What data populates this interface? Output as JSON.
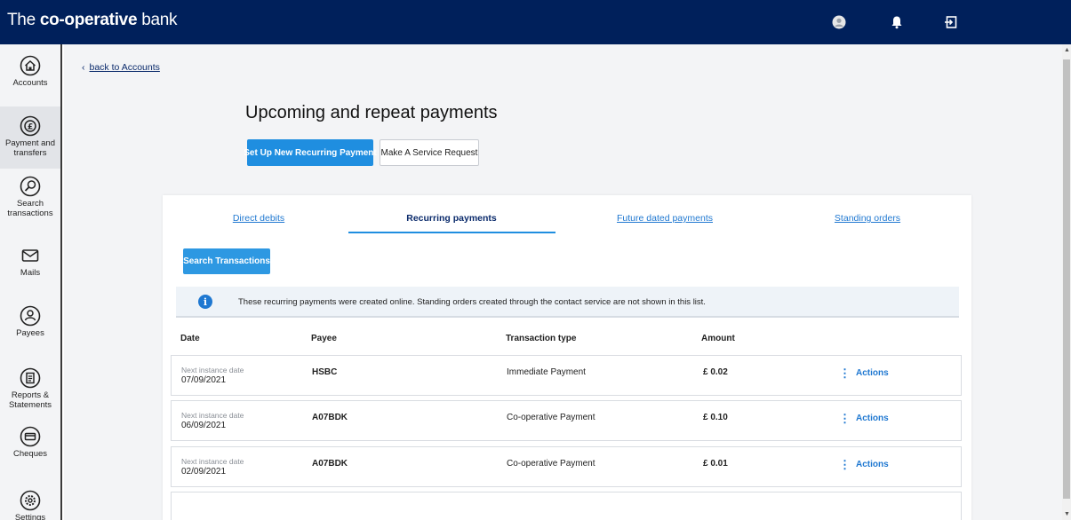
{
  "header": {
    "brand_prefix": "The ",
    "brand_bold": "co-operative",
    "brand_suffix": " bank",
    "colors": {
      "bar": "#00205b",
      "accent": "#1f8ee0",
      "link": "#1f78d1"
    },
    "icons": [
      "user-avatar-icon",
      "bell-icon",
      "logout-icon"
    ]
  },
  "sidebar": {
    "items": [
      {
        "label": "Accounts",
        "icon": "home-icon"
      },
      {
        "label": "Payment and\ntransfers",
        "icon": "payment-icon"
      },
      {
        "label": "Search\ntransactions",
        "icon": "search-icon"
      },
      {
        "label": "Mails",
        "icon": "mail-icon"
      },
      {
        "label": "Payees",
        "icon": "person-icon"
      },
      {
        "label": "Reports &\nStatements",
        "icon": "document-icon"
      },
      {
        "label": "Cheques",
        "icon": "cheque-icon"
      },
      {
        "label": "Settings",
        "icon": "gear-icon"
      }
    ]
  },
  "main": {
    "back_link": "back to Accounts",
    "title": "Upcoming and repeat payments",
    "primary_button": "Set Up New Recurring Payment",
    "secondary_button": "Make A Service Request"
  },
  "tabs": [
    {
      "label": "Direct debits"
    },
    {
      "label": "Recurring payments"
    },
    {
      "label": "Future dated payments"
    },
    {
      "label": "Standing orders"
    }
  ],
  "search_button": "Search Transactions",
  "info_text": "These recurring payments were created online. Standing orders created through the contact service are not shown in this list.",
  "table": {
    "headers": [
      "Date",
      "Payee",
      "Transaction type",
      "Amount"
    ],
    "rows": [
      {
        "date_label": "Next instance date",
        "date": "07/09/2021",
        "payee": "HSBC",
        "type": "Immediate Payment",
        "amount": "£ 0.02",
        "action": "Actions"
      },
      {
        "date_label": "Next instance date",
        "date": "06/09/2021",
        "payee": "A07BDK",
        "type": "Co-operative Payment",
        "amount": "£ 0.10",
        "action": "Actions"
      },
      {
        "date_label": "Next instance date",
        "date": "02/09/2021",
        "payee": "A07BDK",
        "type": "Co-operative Payment",
        "amount": "£ 0.01",
        "action": "Actions"
      }
    ]
  }
}
